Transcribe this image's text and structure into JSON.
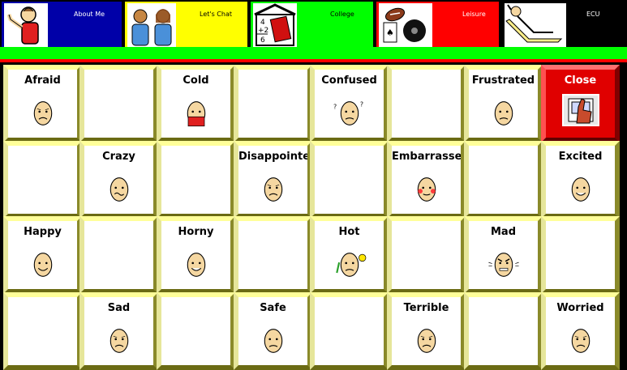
{
  "tabs": [
    {
      "id": "about",
      "label": "About Me"
    },
    {
      "id": "chat",
      "label": "Let's Chat"
    },
    {
      "id": "college",
      "label": "College"
    },
    {
      "id": "leisure",
      "label": "Leisure"
    },
    {
      "id": "ecu",
      "label": "ECU"
    }
  ],
  "college_thumb_text": {
    "line1": "4",
    "line2": "+2",
    "line3": "6"
  },
  "grid": {
    "rows": [
      [
        "Afraid",
        "",
        "Cold",
        "",
        "Confused",
        "",
        "Frustrated",
        "Close"
      ],
      [
        "",
        "Crazy",
        "",
        "Disappointed",
        "",
        "Embarrassed",
        "",
        "Excited"
      ],
      [
        "Happy",
        "",
        "Horny",
        "",
        "Hot",
        "",
        "Mad",
        ""
      ],
      [
        "",
        "Sad",
        "",
        "Safe",
        "",
        "Terrible",
        "",
        "Worried"
      ]
    ]
  },
  "colors": {
    "about_tab": "#0000a8",
    "chat_tab": "#ffff00",
    "college_tab": "#00ff00",
    "leisure_tab": "#ff0000",
    "ecu_tab": "#000000",
    "close_button": "#e00000",
    "cell_border": "#ffff99"
  },
  "icons": {
    "afraid": "afraid-face-icon",
    "cold": "cold-person-icon",
    "confused": "confused-face-icon",
    "frustrated": "frustrated-face-icon",
    "close": "close-hand-icon",
    "crazy": "crazy-face-icon",
    "disappointed": "disappointed-face-icon",
    "embarrassed": "embarrassed-face-icon",
    "excited": "excited-face-icon",
    "happy": "happy-face-icon",
    "horny": "horny-face-icon",
    "hot": "hot-face-icon",
    "mad": "mad-face-icon",
    "sad": "sad-face-icon",
    "safe": "safe-face-icon",
    "terrible": "terrible-face-icon",
    "worried": "worried-face-icon"
  }
}
